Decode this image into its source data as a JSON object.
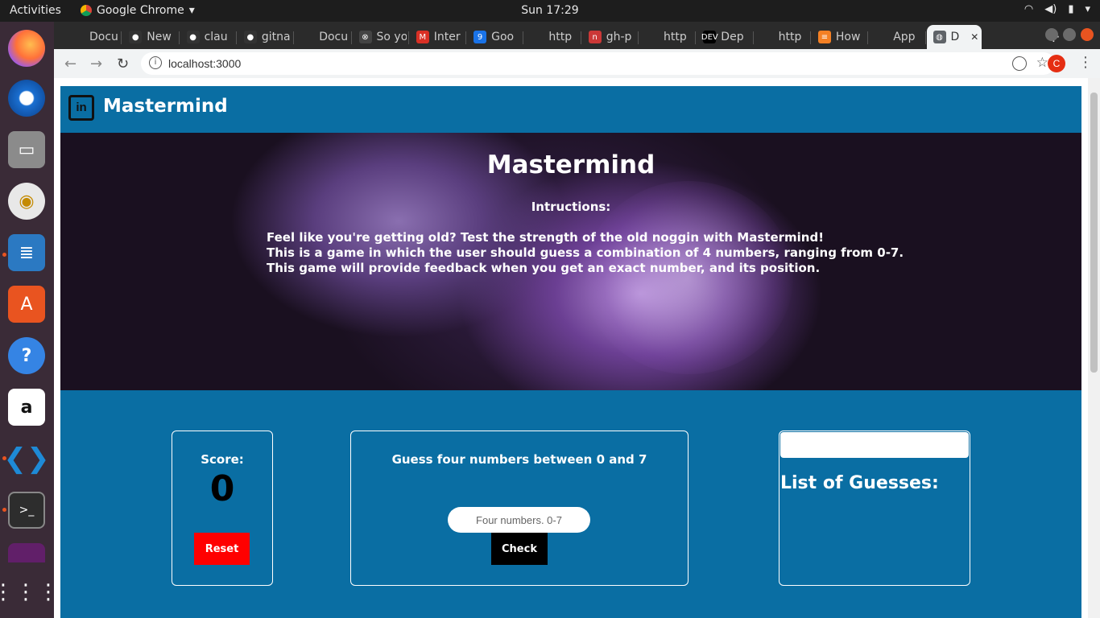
{
  "os": {
    "activities": "Activities",
    "app_name": "Google Chrome",
    "clock": "Sun 17:29"
  },
  "browser": {
    "tabs": [
      {
        "label": "Docu",
        "icon": "doc-icon"
      },
      {
        "label": "New",
        "icon": "github-icon"
      },
      {
        "label": "clau",
        "icon": "github-icon"
      },
      {
        "label": "gitna",
        "icon": "github-icon"
      },
      {
        "label": "Docu",
        "icon": "doc-icon"
      },
      {
        "label": "So yo",
        "icon": "x-circle-icon"
      },
      {
        "label": "Inter",
        "icon": "gmail-icon"
      },
      {
        "label": "Goo",
        "icon": "calendar-icon"
      },
      {
        "label": "http",
        "icon": "page-icon"
      },
      {
        "label": "gh-p",
        "icon": "npm-icon"
      },
      {
        "label": "http",
        "icon": "page-icon"
      },
      {
        "label": "Dep",
        "icon": "dev-icon"
      },
      {
        "label": "http",
        "icon": "page-icon"
      },
      {
        "label": "How",
        "icon": "stackoverflow-icon"
      },
      {
        "label": "App",
        "icon": "page-icon"
      },
      {
        "label": "D",
        "icon": "globe-icon",
        "active": true
      }
    ],
    "url": "localhost:3000",
    "profile_initial": "C"
  },
  "site": {
    "brand": "Mastermind",
    "logo_text": "in",
    "hero": {
      "title": "Mastermind",
      "subtitle": "Intructions:",
      "lines": [
        "Feel like you're getting old? Test the strength of the old noggin with Mastermind!",
        "This is a game in which the user should guess a combination of 4 numbers, ranging from 0-7.",
        "This game will provide feedback when you get an exact number, and its position."
      ]
    },
    "score": {
      "label": "Score:",
      "value": "0",
      "reset_label": "Reset"
    },
    "guess": {
      "prompt": "Guess four numbers between 0 and 7",
      "placeholder": "Four numbers. 0-7",
      "check_label": "Check"
    },
    "guesses": {
      "title": "List of Guesses:"
    }
  },
  "colors": {
    "page_blue": "#0a6ea3",
    "reset_red": "#ff0000",
    "check_black": "#000000"
  }
}
